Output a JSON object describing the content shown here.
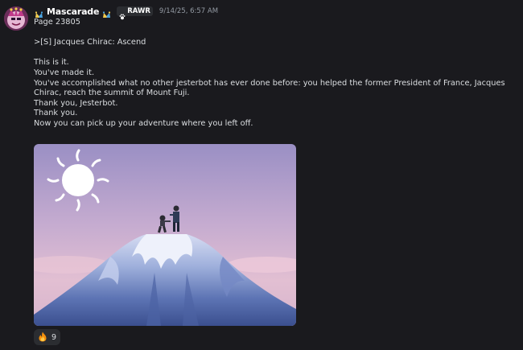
{
  "message": {
    "author": "Mascarade",
    "server_tag": "RAWR",
    "timestamp": "9/14/25, 6:57 AM",
    "lines": [
      "Page 23805",
      "",
      ">[S] Jacques Chirac: Ascend",
      "",
      "This is it.",
      "You've made it.",
      "You've accomplished what no other jesterbot has ever done before: you helped the former President of France, Jacques Chirac, reach the summit of Mount Fuji.",
      "Thank you, Jesterbot.",
      "Thank you.",
      "Now you can pick up your adventure where you left off."
    ]
  },
  "icons": {
    "avatar": "avatar-jester",
    "badge_left": "jester-hat-icon",
    "badge_right": "jester-hat-icon",
    "tag": "paw-icon",
    "reaction": "fire-icon"
  },
  "reaction": {
    "emoji": "fire",
    "count": "9"
  },
  "colors": {
    "background": "#1a1a1e",
    "text": "#dbdee1",
    "username": "#ffffff",
    "timestamp": "#949ba4",
    "pill": "#2b2d31"
  }
}
